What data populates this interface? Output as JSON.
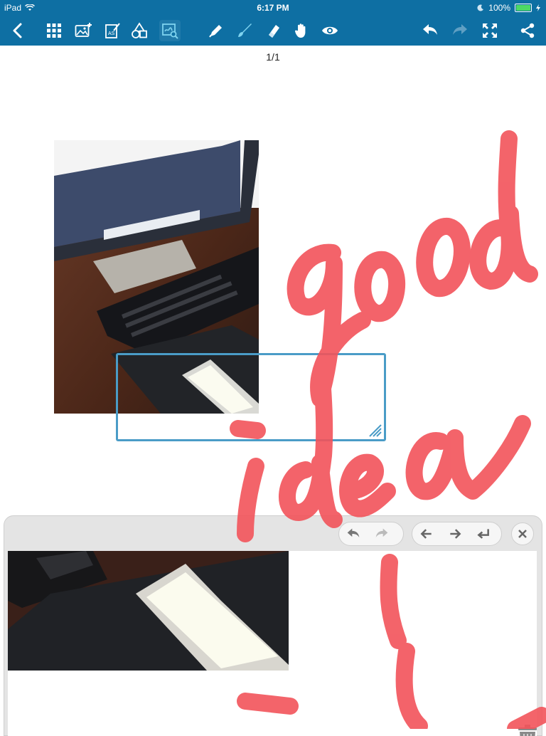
{
  "status": {
    "carrier": "iPad",
    "time": "6:17 PM",
    "battery": "100%"
  },
  "toolbar": {
    "icons": {
      "back": "chevron-left-icon",
      "grid": "grid-icon",
      "add_image": "add-image-icon",
      "text": "text-edit-icon",
      "shapes": "shapes-icon",
      "zoom_write": "zoom-write-icon",
      "pen": "pen-icon",
      "brush": "brush-icon",
      "eraser": "eraser-icon",
      "hand": "hand-icon",
      "eye": "eye-icon",
      "undo": "undo-icon",
      "redo": "redo-icon",
      "fullscreen": "fullscreen-icon",
      "share": "share-icon"
    },
    "active_tool": "brush",
    "color": "#0e6fa3"
  },
  "page_indicator": "1/1",
  "ink_color": "#f2535a",
  "handwriting": [
    "good",
    "idea"
  ],
  "zoom_panel": {
    "icons": [
      "undo-icon",
      "redo-icon",
      "move-left-icon",
      "move-right-icon",
      "new-line-icon",
      "close-icon",
      "trash-icon"
    ]
  }
}
